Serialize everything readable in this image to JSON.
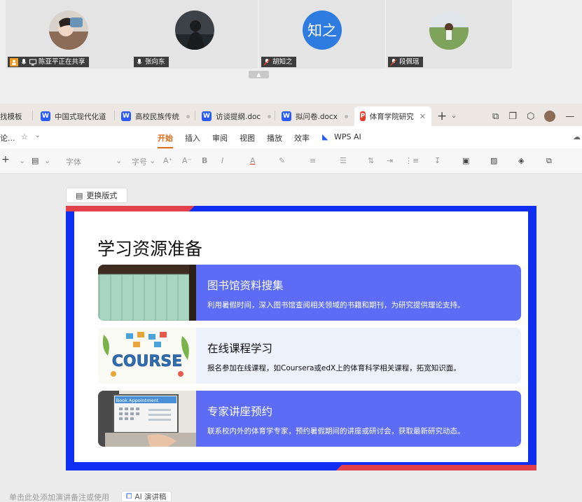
{
  "participants": [
    {
      "name": "陈亚平正在共享",
      "avatar": "photo"
    },
    {
      "name": "张向东",
      "avatar": "photo"
    },
    {
      "name": "胡知之",
      "avatar": "text",
      "avatar_text": "知之",
      "avatar_color": "#2e7ce0"
    },
    {
      "name": "段佩瑶",
      "avatar": "photo"
    }
  ],
  "tabs": [
    {
      "label": "找模板",
      "icon": "none"
    },
    {
      "label": "中国式现代化道",
      "icon": "word-icon"
    },
    {
      "label": "高校民族传统",
      "icon": "word-icon"
    },
    {
      "label": "访谈提纲.doc",
      "icon": "word-icon"
    },
    {
      "label": "拟问卷.docx",
      "icon": "word-icon"
    },
    {
      "label": "体育学院研究",
      "icon": "ppt-icon",
      "active": true
    }
  ],
  "file_label": "论...",
  "menus": [
    "开始",
    "插入",
    "审阅",
    "视图",
    "播放",
    "效率",
    "WPS AI"
  ],
  "active_menu": "开始",
  "toolbar": {
    "font": "字体",
    "size": "字号"
  },
  "layout_button": "更换版式",
  "slide": {
    "title": "学习资源准备",
    "cards": [
      {
        "title": "图书馆资料搜集",
        "desc": "利用暑假时间，深入图书馆查阅相关领域的书籍和期刊，为研究提供理论支持。",
        "style": "blue"
      },
      {
        "title": "在线课程学习",
        "desc": "报名参加在线课程，如Coursera或edX上的体育科学相关课程，拓宽知识面。",
        "style": "light",
        "image_text": "COURSE"
      },
      {
        "title": "专家讲座预约",
        "desc": "联系校内外的体育学专家，预约暑假期间的讲座或研讨会，获取最新研究动态。",
        "style": "blue",
        "image_text": "Book Appointment"
      }
    ]
  },
  "footer": {
    "notes": "单击此处添加演讲备注或使用",
    "ai_button": "AI 演讲稿"
  },
  "colors": {
    "accent": "#e06a14",
    "slide_border": "#0f2ef2",
    "slide_red": "#e2404a",
    "card_blue": "#5c6cf5"
  }
}
